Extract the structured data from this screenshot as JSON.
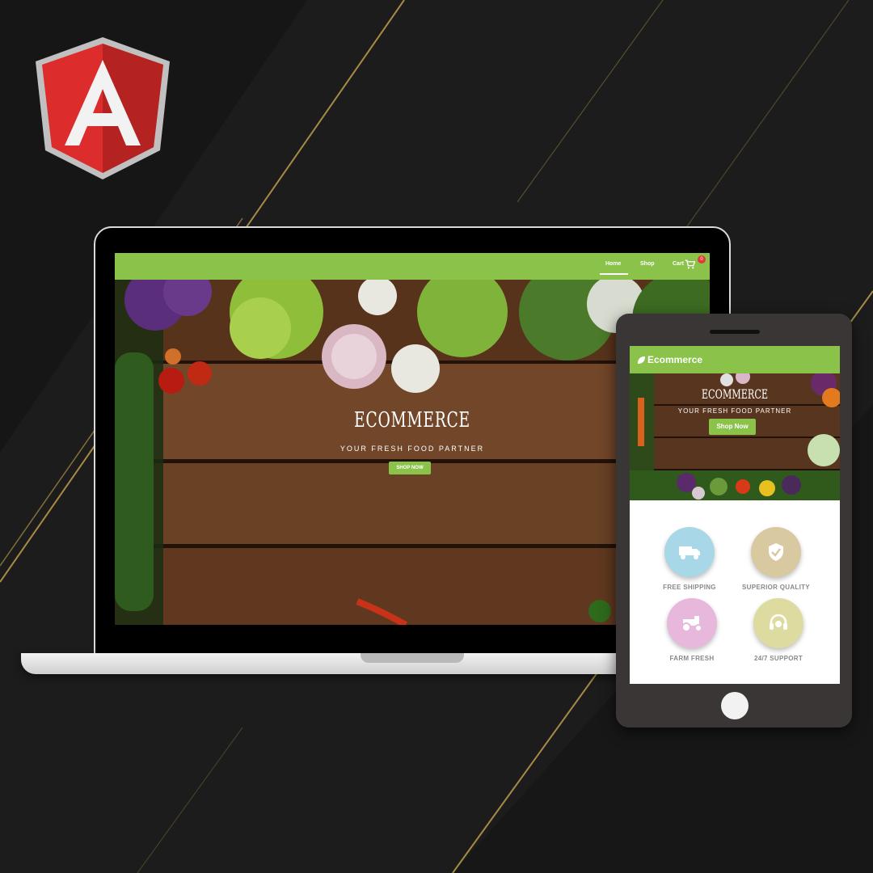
{
  "logo": {
    "letter": "A",
    "name": "angular-logo"
  },
  "laptop": {
    "nav": {
      "home": "Home",
      "shop": "Shop",
      "cart": "Cart",
      "cart_count": "0"
    },
    "hero": {
      "title": "ECOMMERCE",
      "tagline": "YOUR FRESH FOOD PARTNER",
      "button": "SHOP NOW"
    }
  },
  "tablet": {
    "brand": "Ecommerce",
    "hero": {
      "title": "ECOMMERCE",
      "tagline": "YOUR FRESH FOOD PARTNER",
      "button": "Shop Now"
    },
    "features": [
      {
        "label": "FREE SHIPPING",
        "icon": "truck-icon",
        "color": "#a8d8e8"
      },
      {
        "label": "SUPERIOR QUALITY",
        "icon": "shield-check-icon",
        "color": "#d9c9a0"
      },
      {
        "label": "FARM FRESH",
        "icon": "tractor-icon",
        "color": "#e7b7dc"
      },
      {
        "label": "24/7 SUPPORT",
        "icon": "headset-icon",
        "color": "#dedba0"
      }
    ]
  },
  "colors": {
    "accent": "#8bc34a",
    "background": "#1c1c1c",
    "gold": "#c9a74e"
  }
}
